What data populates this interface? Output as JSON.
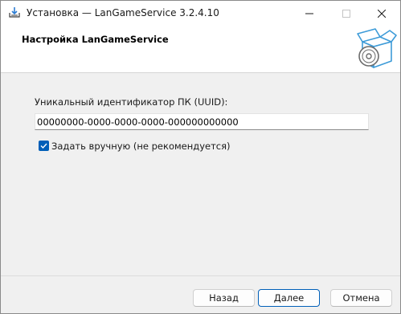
{
  "window": {
    "title": "Установка — LanGameService 3.2.4.10"
  },
  "header": {
    "title": "Настройка LanGameService"
  },
  "form": {
    "uuid_label": "Уникальный идентификатор ПК (UUID):",
    "uuid_value": "00000000-0000-0000-0000-000000000000",
    "manual_checkbox_label": "Задать вручную (не рекомендуется)",
    "manual_checked": true
  },
  "footer": {
    "back_label": "Назад",
    "next_label": "Далее",
    "cancel_label": "Отмена"
  },
  "icons": {
    "app": "installer-download-icon",
    "header_art": "box-with-disc-icon",
    "minimize": "minimize-icon",
    "maximize": "maximize-icon",
    "close": "close-icon"
  },
  "colors": {
    "accent": "#005fb8",
    "header_art": "#3d9bd8"
  }
}
